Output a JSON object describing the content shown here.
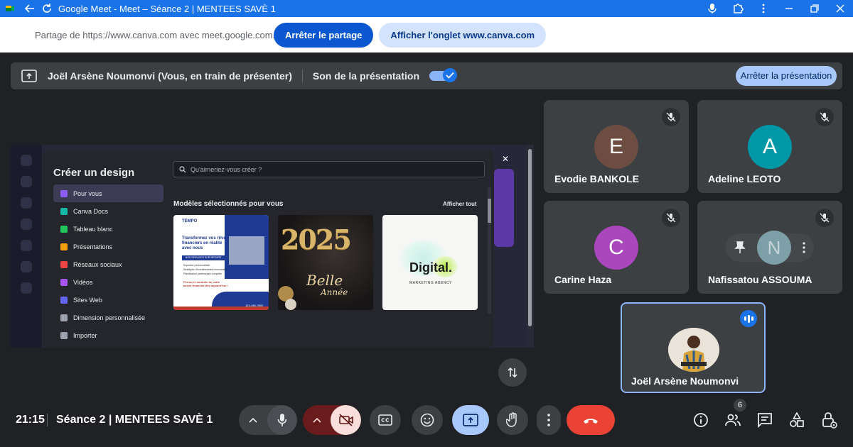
{
  "window": {
    "title": "Google Meet - Meet – Séance 2 | MENTEES SAVÈ 1"
  },
  "share_bar": {
    "message": "Partage de https://www.canva.com avec meet.google.com...",
    "stop_sharing_label": "Arrêter le partage",
    "show_tab_label": "Afficher l'onglet www.canva.com"
  },
  "presenting_bar": {
    "presenter_text": "Joël Arsène Noumonvi (Vous, en train de présenter)",
    "sound_label": "Son de la présentation",
    "sound_enabled": true,
    "stop_presenting_label": "Arrêter la présentation"
  },
  "shared_screen": {
    "panel_title": "Créer un design",
    "search_placeholder": "Qu'aimeriez-vous créer ?",
    "menu": [
      {
        "label": "Pour vous",
        "color": "#8b5cf6",
        "active": true
      },
      {
        "label": "Canva Docs",
        "color": "#14b8a6"
      },
      {
        "label": "Tableau blanc",
        "color": "#22c55e"
      },
      {
        "label": "Présentations",
        "color": "#f59e0b"
      },
      {
        "label": "Réseaux sociaux",
        "color": "#ef4444"
      },
      {
        "label": "Vidéos",
        "color": "#a855f7"
      },
      {
        "label": "Sites Web",
        "color": "#6366f1"
      },
      {
        "label": "Dimension personnalisée",
        "color": "#9ca3af"
      },
      {
        "label": "Importer",
        "color": "#9ca3af"
      }
    ],
    "section_title": "Modèles sélectionnés pour vous",
    "see_all_label": "Afficher tout",
    "templates": {
      "t1_brand": "TEMPO",
      "t1_headline": "Transformez vos rêves financiers en réalité avec nous",
      "t1_services": "NOS SERVICES SUR MESURE",
      "t1_items": [
        "Expertise personnalisée",
        "Stratégies d'investissement innovantes",
        "Planification patrimoniale complète"
      ],
      "t1_cta": "Prenez le contrôle de votre avenir financier dès aujourd'hui !",
      "t1_phone": "123-456-7890",
      "t2_year": "2025",
      "t2_line1": "Belle",
      "t2_line2": "Année",
      "t3_title": "Digital.",
      "t3_subtitle": "MARKETING AGENCY"
    }
  },
  "participants": [
    {
      "name": "Evodie BANKOLE",
      "initial": "E",
      "color": "#6d4c41",
      "muted": true
    },
    {
      "name": "Adeline LEOTO",
      "initial": "A",
      "color": "#0097a7",
      "muted": true
    },
    {
      "name": "Carine Haza",
      "initial": "C",
      "color": "#ab47bc",
      "muted": true
    },
    {
      "name": "Nafissatou ASSOUMA",
      "initial": "N",
      "color": "#7d9fa7",
      "muted": true
    }
  ],
  "self": {
    "name": "Joël Arsène Noumonvi",
    "speaking": true
  },
  "bottom_bar": {
    "time": "21:15",
    "meeting_name": "Séance 2 | MENTEES SAVÈ 1",
    "participant_count": "6"
  },
  "colors": {
    "accent": "#1a73e8",
    "end_call": "#ea4335",
    "camera_off_bg": "#f9dedc",
    "present_active_bg": "#a8c7fa"
  },
  "icons": [
    "back-icon",
    "reload-icon",
    "mic-icon",
    "extension-icon",
    "more-vert-icon",
    "minimize-icon",
    "restore-icon",
    "close-icon",
    "present-icon",
    "check-icon",
    "search-icon",
    "mic-off-icon",
    "pin-icon",
    "swap-icon",
    "chevron-up-icon",
    "camera-off-icon",
    "captions-icon",
    "emoji-icon",
    "raise-hand-icon",
    "end-call-icon",
    "info-icon",
    "people-icon",
    "chat-icon",
    "activities-icon",
    "lock-icon"
  ]
}
